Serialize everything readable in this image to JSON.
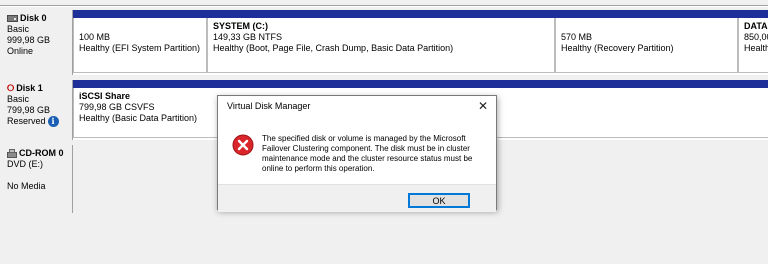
{
  "disks": [
    {
      "name": "Disk 0",
      "lines": [
        "Basic",
        "999,98 GB",
        "Online"
      ],
      "partitions": [
        {
          "title": "",
          "size": "100 MB",
          "status": "Healthy (EFI System Partition)"
        },
        {
          "title": "SYSTEM  (C:)",
          "size": "149,33 GB NTFS",
          "status": "Healthy (Boot, Page File, Crash Dump, Basic Data Partition)"
        },
        {
          "title": "",
          "size": "570 MB",
          "status": "Healthy (Recovery Partition)"
        },
        {
          "title": "DATA",
          "size": "850,00",
          "status": "Health"
        }
      ]
    },
    {
      "name": "Disk 1",
      "lines": [
        "Basic",
        "799,98 GB",
        "Reserved"
      ],
      "partitions": [
        {
          "title": "iSCSI Share",
          "size": "799,98 GB CSVFS",
          "status": "Healthy (Basic Data Partition)"
        }
      ]
    },
    {
      "name": "CD-ROM 0",
      "lines": [
        "DVD (E:)",
        "",
        "No Media"
      ]
    }
  ],
  "dialog": {
    "title": "Virtual Disk Manager",
    "close": "✕",
    "message": "The specified disk or volume is managed by the Microsoft Failover Clustering component. The disk must be in cluster maintenance mode and the cluster resource status must be online to perform this operation.",
    "ok_label": "OK"
  },
  "colors": {
    "partition_bar": "#1f2f9a",
    "error_red": "#d9262b",
    "info_blue": "#1a5fb4"
  },
  "icons": {
    "disk": "hard-disk-icon",
    "disk1_status": "offline-arrow-icon",
    "info": "info-icon",
    "cd": "cd-rom-icon",
    "error": "error-icon"
  }
}
